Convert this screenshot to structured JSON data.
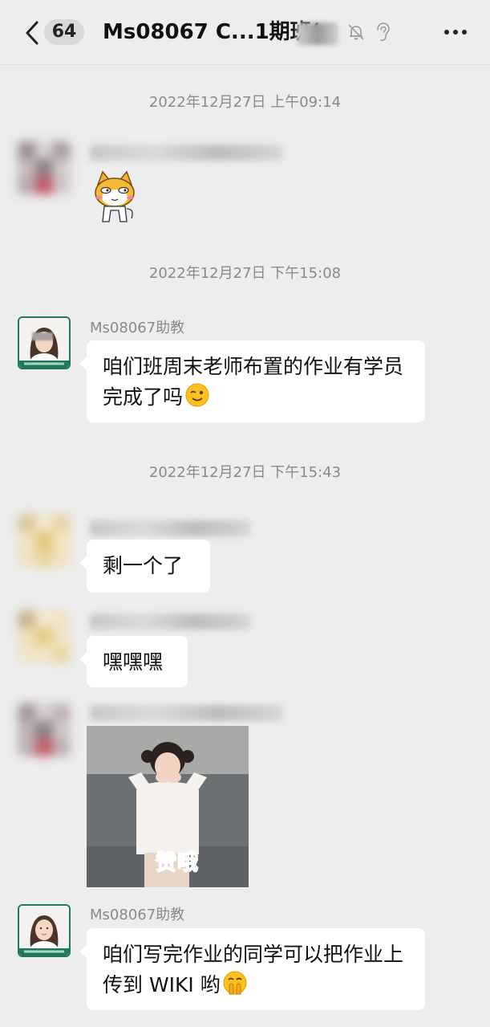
{
  "header": {
    "unread_count": "64",
    "title": "Ms08067 C...1期班("
  },
  "messages": {
    "ts1": "2022年12月27日 上午09:14",
    "ts2": "2022年12月27日 下午15:08",
    "ts3": "2022年12月27日 下午15:43",
    "assistant_name_1": "Ms08067助教",
    "assistant_msg_1": "咱们班周末老师布置的作业有学员完成了吗",
    "reply_1": "剩一个了",
    "reply_2": "嘿嘿嘿",
    "photo_caption": "赞哦",
    "assistant_name_2": "Ms08067助教",
    "assistant_msg_2": "咱们写完作业的同学可以把作业上传到 WIKI 哟"
  },
  "colors": {
    "background": "#ededed",
    "bubble": "#ffffff",
    "timestamp_text": "#8a8a8a",
    "avatar_frame": "#1e7a5a"
  },
  "icons": [
    "back-icon",
    "mute-bell-icon",
    "ear-icon",
    "more-icon",
    "shiba-sticker",
    "wink-emoji-icon",
    "shush-emoji-icon"
  ]
}
